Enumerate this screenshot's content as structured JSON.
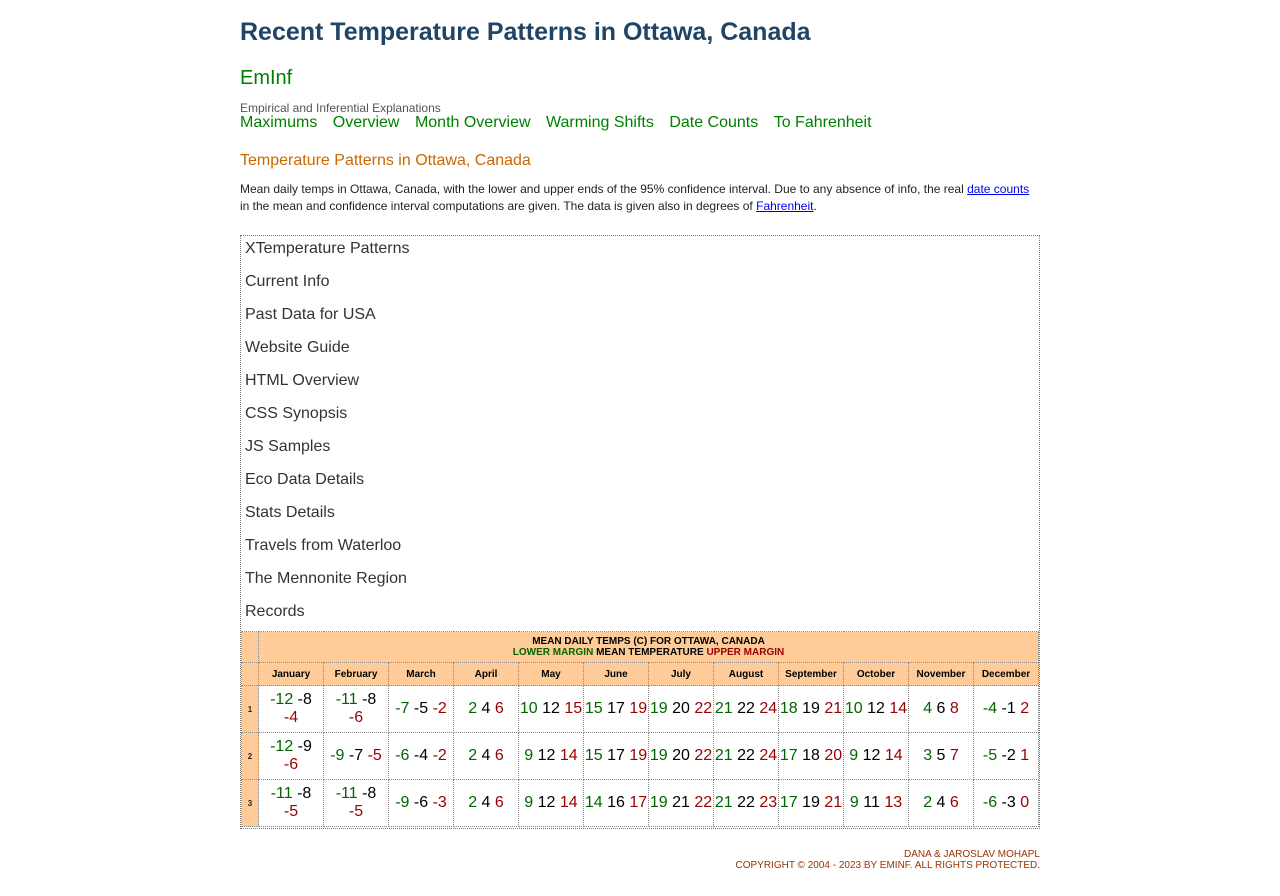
{
  "page_title": "Recent Temperature Patterns in Ottawa, Canada",
  "brand": "EmInf",
  "tagline": "Empirical and Inferential Explanations",
  "top_nav": [
    "Maximums",
    "Overview",
    "Month Overview",
    "Warming Shifts",
    "Date Counts",
    "To Fahrenheit"
  ],
  "section_title": "Temperature Patterns in Ottawa, Canada",
  "description": {
    "part1": "Mean daily temps in Ottawa, Canada, with the lower and upper ends of the 95% confidence interval. Due to any absence of info, the real ",
    "link1": "date counts",
    "part2": " in the mean and confidence interval computations are given. The data is given also in degrees of ",
    "link2": "Fahrenheit",
    "part3": "."
  },
  "side_nav": [
    "XTemperature Patterns",
    "Current Info",
    "Past Data for USA",
    "Website Guide",
    "HTML Overview",
    "CSS Synopsis",
    "JS Samples",
    "Eco Data Details",
    "Stats Details",
    "Travels from Waterloo",
    "The Mennonite Region",
    "Records"
  ],
  "table": {
    "caption_line1": "MEAN DAILY TEMPS (C) FOR OTTAWA, CANADA",
    "legend_lower": "LOWER MARGIN",
    "legend_mean": "MEAN TEMPERATURE",
    "legend_upper": "UPPER MARGIN",
    "months": [
      "January",
      "February",
      "March",
      "April",
      "May",
      "June",
      "July",
      "August",
      "September",
      "October",
      "November",
      "December"
    ],
    "rows": [
      {
        "day": "1",
        "cells": [
          [
            "-12",
            "-8",
            "-4"
          ],
          [
            "-11",
            "-8",
            "-6"
          ],
          [
            "-7",
            "-5",
            "-2"
          ],
          [
            "2",
            "4",
            "6"
          ],
          [
            "10",
            "12",
            "15"
          ],
          [
            "15",
            "17",
            "19"
          ],
          [
            "19",
            "20",
            "22"
          ],
          [
            "21",
            "22",
            "24"
          ],
          [
            "18",
            "19",
            "21"
          ],
          [
            "10",
            "12",
            "14"
          ],
          [
            "4",
            "6",
            "8"
          ],
          [
            "-4",
            "-1",
            "2"
          ]
        ]
      },
      {
        "day": "2",
        "cells": [
          [
            "-12",
            "-9",
            "-6"
          ],
          [
            "-9",
            "-7",
            "-5"
          ],
          [
            "-6",
            "-4",
            "-2"
          ],
          [
            "2",
            "4",
            "6"
          ],
          [
            "9",
            "12",
            "14"
          ],
          [
            "15",
            "17",
            "19"
          ],
          [
            "19",
            "20",
            "22"
          ],
          [
            "21",
            "22",
            "24"
          ],
          [
            "17",
            "18",
            "20"
          ],
          [
            "9",
            "12",
            "14"
          ],
          [
            "3",
            "5",
            "7"
          ],
          [
            "-5",
            "-2",
            "1"
          ]
        ]
      },
      {
        "day": "3",
        "cells": [
          [
            "-11",
            "-8",
            "-5"
          ],
          [
            "-11",
            "-8",
            "-5"
          ],
          [
            "-9",
            "-6",
            "-3"
          ],
          [
            "2",
            "4",
            "6"
          ],
          [
            "9",
            "12",
            "14"
          ],
          [
            "14",
            "16",
            "17"
          ],
          [
            "19",
            "21",
            "22"
          ],
          [
            "21",
            "22",
            "23"
          ],
          [
            "17",
            "19",
            "21"
          ],
          [
            "9",
            "11",
            "13"
          ],
          [
            "2",
            "4",
            "6"
          ],
          [
            "-6",
            "-3",
            "0"
          ]
        ]
      }
    ]
  },
  "footer": {
    "line1": "DANA & JAROSLAV MOHAPL",
    "line2": "COPYRIGHT © 2004 - 2023 BY EMINF. ALL RIGHTS PROTECTED."
  }
}
